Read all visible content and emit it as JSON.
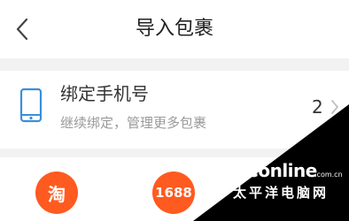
{
  "header": {
    "title": "导入包裹",
    "back_icon": "chevron-left-icon"
  },
  "bind_card": {
    "title": "绑定手机号",
    "subtitle": "继续绑定，管理更多包裹",
    "count": "2",
    "icon": "phone-icon",
    "chevron_icon": "chevron-right-icon"
  },
  "platforms": [
    {
      "label": "淘",
      "color": "#ff5a1f"
    },
    {
      "label": "1688",
      "color": "#ff5a1f"
    }
  ],
  "watermark": {
    "brand": "PConline",
    "domain": ".com.cn",
    "cn": "太平洋电脑网"
  }
}
